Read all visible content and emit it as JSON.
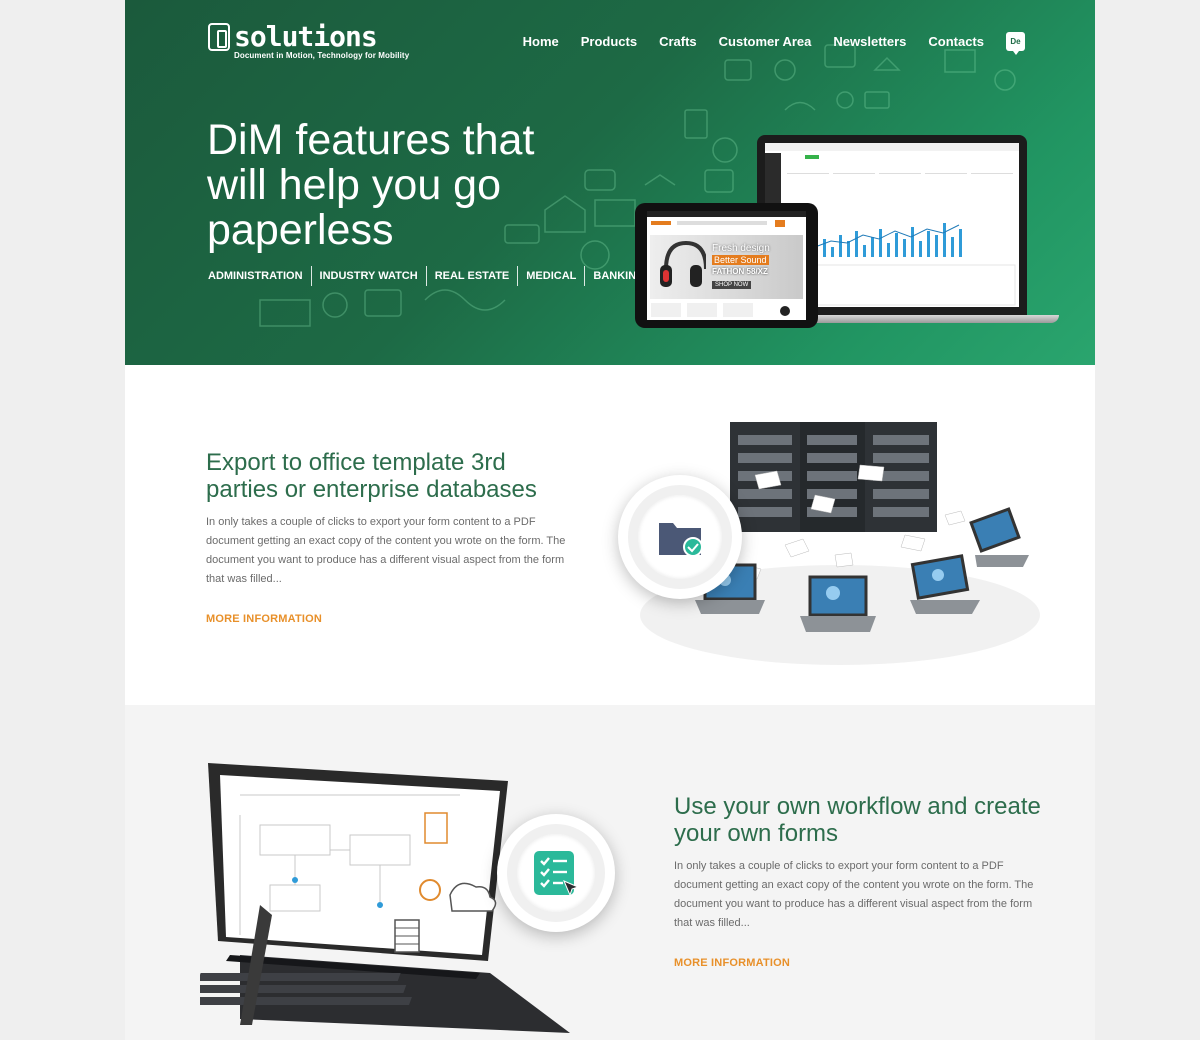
{
  "brand": {
    "name": "solutions",
    "tagline": "Document in Motion, Technology for Mobility"
  },
  "nav": {
    "items": [
      "Home",
      "Products",
      "Crafts",
      "Customer Area",
      "Newsletters",
      "Contacts"
    ],
    "language": "De"
  },
  "hero": {
    "title": "DiM features that will help you go paperless",
    "sectors": [
      "ADMINISTRATION",
      "INDUSTRY WATCH",
      "REAL ESTATE",
      "MEDICAL",
      "BANKING"
    ],
    "tablet_banner": {
      "line1": "Fresh design",
      "line2": "Better Sound",
      "line3": "FATHON 58/XZ",
      "cta": "SHOP NOW"
    }
  },
  "section_export": {
    "title": "Export to office template 3rd parties or enterprise databases",
    "body": "In only takes a couple of clicks to export your form content to a PDF document getting an exact copy of the content you wrote on the form. The document you want to produce has a different visual aspect from the form that was filled...",
    "link": "MORE INFORMATION"
  },
  "section_workflow": {
    "title": "Use your own workflow and create your own forms",
    "body": "In only takes a couple of clicks to export your form content to a PDF document getting an exact copy of the content you wrote on the form. The document you want to produce has a different visual aspect from the form that was filled...",
    "link": "MORE INFORMATION"
  },
  "colors": {
    "hero_green": "#1d6a45",
    "title_green": "#2d6d4c",
    "accent_orange": "#e8902a",
    "badge_teal": "#2bb99a",
    "folder_slate": "#4b5876"
  }
}
